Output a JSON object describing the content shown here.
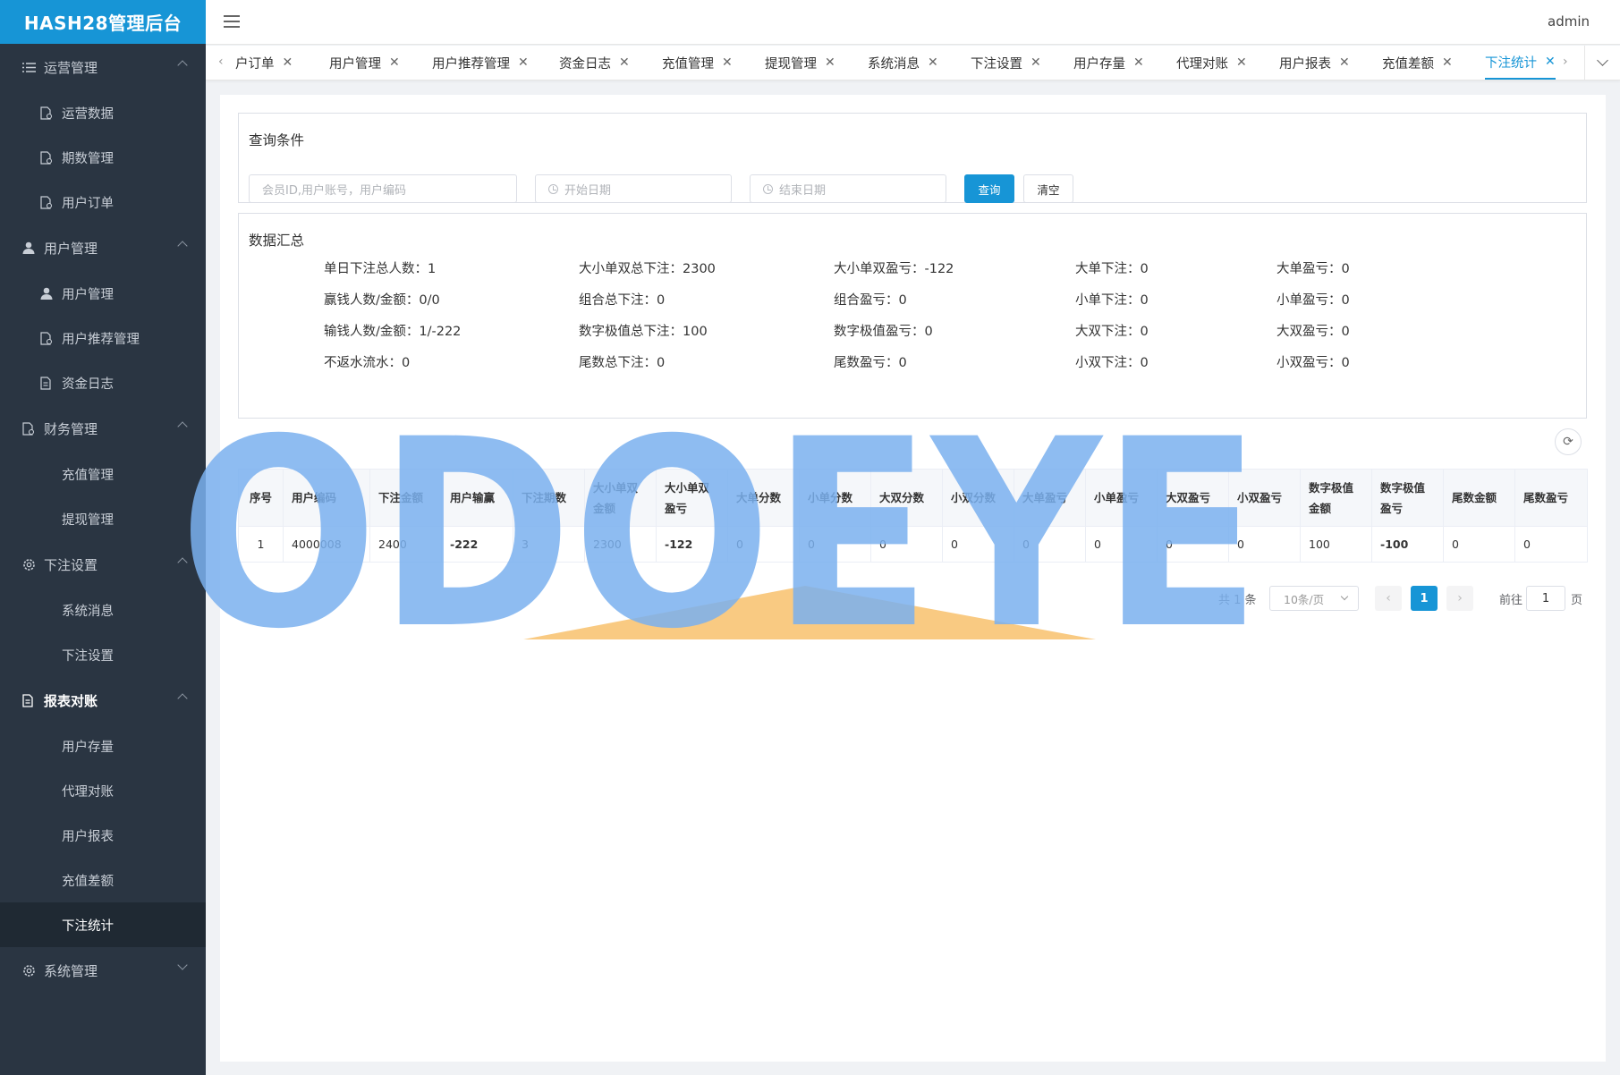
{
  "app": {
    "title": "HASH28管理后台",
    "user": "admin"
  },
  "sidebar": {
    "groups": [
      {
        "label": "运营管理",
        "icon": "list-icon",
        "items": [
          "运营数据",
          "期数管理",
          "用户订单"
        ]
      },
      {
        "label": "用户管理",
        "icon": "user-icon",
        "items": [
          "用户管理",
          "用户推荐管理",
          "资金日志"
        ]
      },
      {
        "label": "财务管理",
        "icon": "finance-icon",
        "items": [
          "充值管理",
          "提现管理"
        ]
      },
      {
        "label": "下注设置",
        "icon": "gear-icon",
        "items": [
          "系统消息",
          "下注设置"
        ]
      },
      {
        "label": "报表对账",
        "icon": "report-icon",
        "items": [
          "用户存量",
          "代理对账",
          "用户报表",
          "充值差额",
          "下注统计"
        ]
      },
      {
        "label": "系统管理",
        "icon": "gear-icon",
        "items": []
      }
    ],
    "active_item": "下注统计"
  },
  "tabs": [
    {
      "label": "户订单"
    },
    {
      "label": "用户管理"
    },
    {
      "label": "用户推荐管理"
    },
    {
      "label": "资金日志"
    },
    {
      "label": "充值管理"
    },
    {
      "label": "提现管理"
    },
    {
      "label": "系统消息"
    },
    {
      "label": "下注设置"
    },
    {
      "label": "用户存量"
    },
    {
      "label": "代理对账"
    },
    {
      "label": "用户报表"
    },
    {
      "label": "充值差额"
    },
    {
      "label": "下注统计"
    }
  ],
  "query": {
    "title": "查询条件",
    "search_placeholder": "会员ID,用户账号，用户编码",
    "start_placeholder": "开始日期",
    "end_placeholder": "结束日期",
    "search_button": "查询",
    "clear_button": "清空"
  },
  "summary": {
    "title": "数据汇总",
    "rows": [
      [
        "单日下注总人数：1",
        "大小单双总下注：2300",
        "大小单双盈亏：-122",
        "大单下注：0",
        "大单盈亏：0"
      ],
      [
        "赢钱人数/金额：0/0",
        "组合总下注：0",
        "组合盈亏：0",
        "小单下注：0",
        "小单盈亏：0"
      ],
      [
        "输钱人数/金额：1/-222",
        "数字极值总下注：100",
        "数字极值盈亏：0",
        "大双下注：0",
        "大双盈亏：0"
      ],
      [
        "不返水流水：0",
        "尾数总下注：0",
        "尾数盈亏：0",
        "小双下注：0",
        "小双盈亏：0"
      ]
    ]
  },
  "table": {
    "headers": [
      "序号",
      "用户编码",
      "下注金额",
      "用户输赢",
      "下注期数",
      "大小单双金额",
      "大小单双盈亏",
      "大单分数",
      "小单分数",
      "大双分数",
      "小双分数",
      "大单盈亏",
      "小单盈亏",
      "大双盈亏",
      "小双盈亏",
      "数字极值金额",
      "数字极值盈亏",
      "尾数金额",
      "尾数盈亏"
    ],
    "rows": [
      [
        "1",
        "4000008",
        "2400",
        "-222",
        "3",
        "2300",
        "-122",
        "0",
        "0",
        "0",
        "0",
        "0",
        "0",
        "0",
        "0",
        "100",
        "-100",
        "0",
        "0"
      ]
    ]
  },
  "pagination": {
    "total": "共 1 条",
    "page_size": "10条/页",
    "current_page": "1",
    "goto_label": "前往",
    "goto_value": "1",
    "page_suffix": "页"
  },
  "watermark": {
    "text": "ODOEYE"
  },
  "colors": {
    "accent": "#1795d6",
    "sidebar": "#2a3542",
    "watermark_blue": "#7ab0ee",
    "watermark_orange": "#f8c577"
  }
}
